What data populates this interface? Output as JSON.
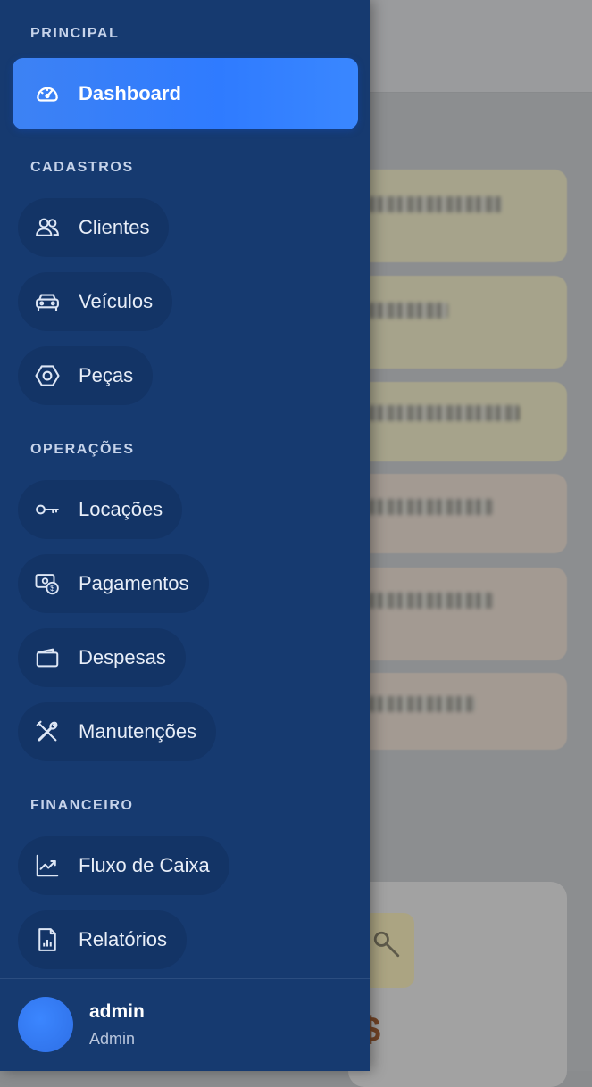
{
  "sections": {
    "principal": "PRINCIPAL",
    "cadastros": "CADASTROS",
    "operacoes": "OPERAÇÕES",
    "financeiro": "FINANCEIRO"
  },
  "nav": {
    "dashboard": {
      "label": "Dashboard",
      "icon": "speedometer-icon",
      "active": true
    },
    "clientes": {
      "label": "Clientes",
      "icon": "users-icon"
    },
    "veiculos": {
      "label": "Veículos",
      "icon": "car-icon"
    },
    "pecas": {
      "label": "Peças",
      "icon": "hexagon-nut-icon"
    },
    "locacoes": {
      "label": "Locações",
      "icon": "key-icon"
    },
    "pagamentos": {
      "label": "Pagamentos",
      "icon": "money-icon"
    },
    "despesas": {
      "label": "Despesas",
      "icon": "wallet-icon"
    },
    "manutencoes": {
      "label": "Manutenções",
      "icon": "tools-icon"
    },
    "fluxo_caixa": {
      "label": "Fluxo de Caixa",
      "icon": "trend-chart-icon"
    },
    "relatorios": {
      "label": "Relatórios",
      "icon": "report-icon"
    }
  },
  "user": {
    "name": "admin",
    "role": "Admin"
  },
  "background": {
    "currency_symbol": "$"
  },
  "colors": {
    "drawer_bg": "#163a70",
    "active_item": "#2f7bff",
    "section_title": "#c6d3ea",
    "avatar": "#3b86ff"
  }
}
